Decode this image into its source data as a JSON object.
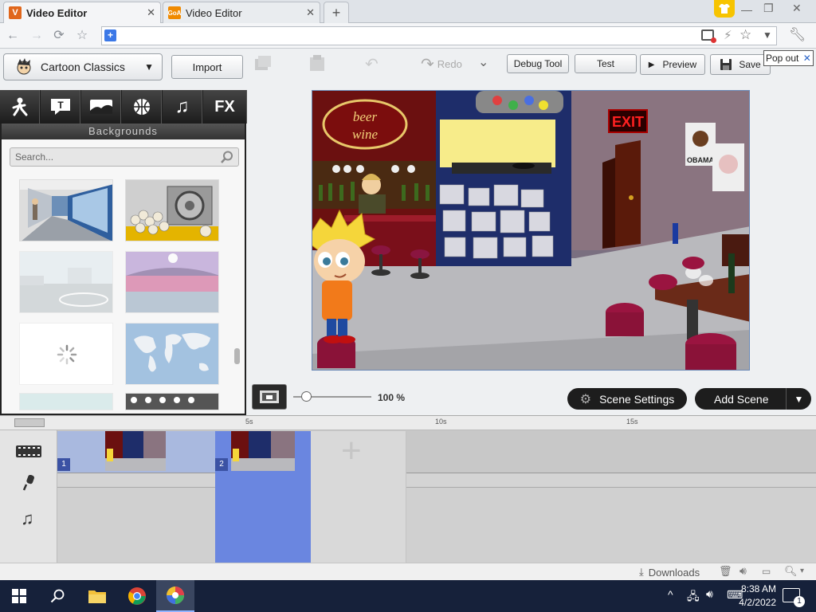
{
  "browser": {
    "tabs": [
      {
        "title": "Video Editor",
        "favicon": "V",
        "favicon_color": "#e0661b",
        "active": true
      },
      {
        "title": "Video Editor",
        "favicon": "GoA",
        "favicon_color": "#f08a00",
        "active": false
      }
    ],
    "new_tab_label": "+",
    "address": ""
  },
  "app": {
    "theme_selector": "Cartoon Classics",
    "import_label": "Import",
    "redo_label": "Redo",
    "debug_label": "Debug Tool",
    "test_label": "Test",
    "preview_label": "Preview",
    "save_label": "Save",
    "popout_label": "Pop out",
    "category_tabs": [
      "character-icon",
      "text-icon",
      "background-icon",
      "prop-icon",
      "music-icon",
      "FX"
    ],
    "fx_label": "FX",
    "backgrounds_title": "Backgrounds",
    "search_placeholder": "Search...",
    "zoom_value": "100 %",
    "scene_settings_label": "Scene Settings",
    "add_scene_label": "Add Scene",
    "stage": {
      "beer_sign_line1": "beer",
      "beer_sign_line2": "wine",
      "exit_sign": "EXIT",
      "poster_text": "OBAMA"
    }
  },
  "timeline": {
    "ticks": [
      "5s",
      "10s",
      "15s"
    ],
    "scenes": [
      {
        "number": "1"
      },
      {
        "number": "2"
      }
    ]
  },
  "status": {
    "downloads_label": "Downloads"
  },
  "taskbar": {
    "time": "8:38 AM",
    "date": "4/2/2022",
    "notification_count": "1"
  },
  "colors": {
    "accent_blue": "#5a78d8",
    "dark_button": "#1d1d1d",
    "taskbar": "#16213a"
  }
}
